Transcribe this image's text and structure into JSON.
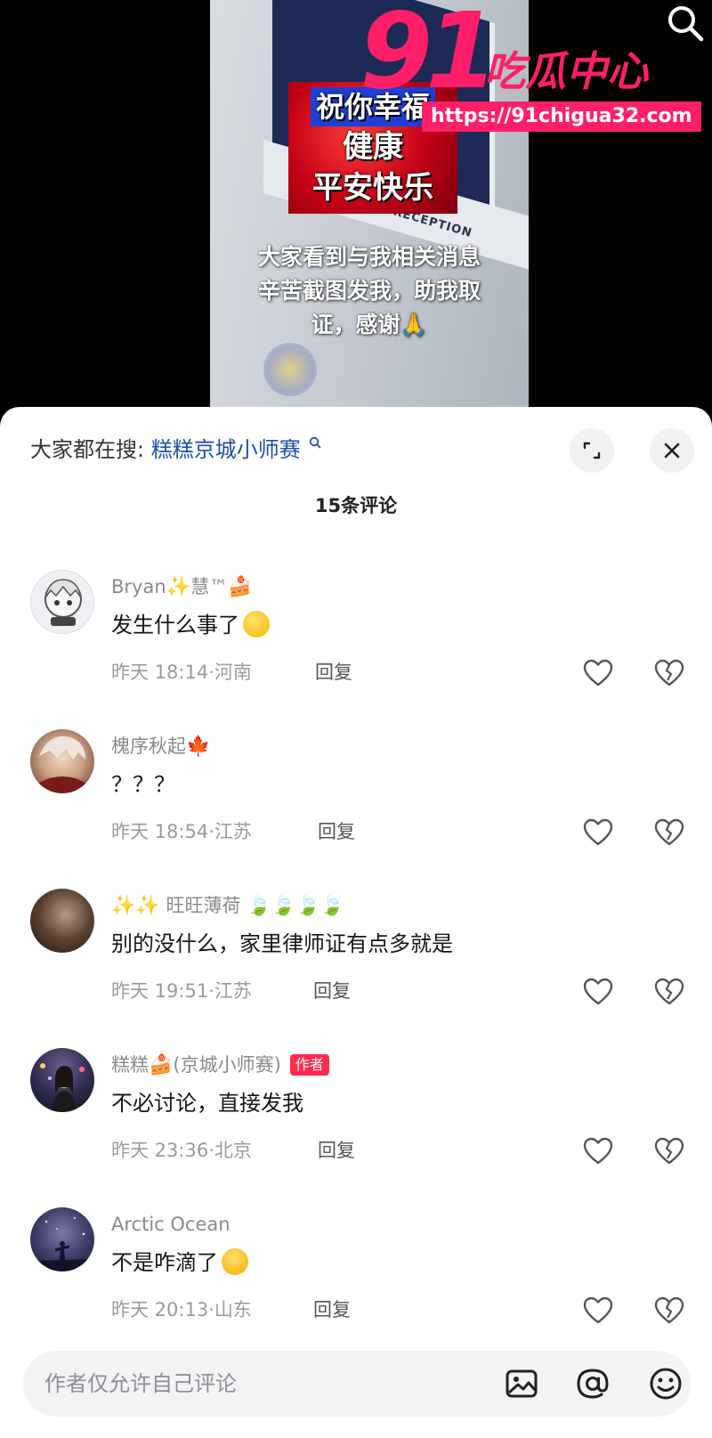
{
  "video": {
    "blessing_lines": [
      "祝你幸福",
      "健康",
      "平安快乐"
    ],
    "sign_text": "POLICE RECEPTION",
    "caption_lines": [
      "大家看到与我相关消息",
      "辛苦截图发我，助我取",
      "证，感谢🙏"
    ]
  },
  "watermark": {
    "number": "91",
    "name": "吃瓜中心",
    "url": "https://91chigua32.com"
  },
  "header": {
    "hot_search_label": "大家都在搜:",
    "hot_search_term": "糕糕京城小师赛",
    "comment_count": "15条评论"
  },
  "comments": [
    {
      "name": "Bryan",
      "name_suffix": "慧™",
      "text": "发生什么事了",
      "time": "昨天 18:14",
      "location": "河南",
      "reply": "回复"
    },
    {
      "name": "槐序秋起",
      "name_suffix": "",
      "text": "？？？",
      "time": "昨天 18:54",
      "location": "江苏",
      "reply": "回复"
    },
    {
      "name": "旺旺薄荷",
      "name_suffix": "",
      "text": "别的没什么，家里律师证有点多就是",
      "time": "昨天 19:51",
      "location": "江苏",
      "reply": "回复"
    },
    {
      "name": "糕糕",
      "name_suffix": "(京城小师赛)",
      "author_tag": "作者",
      "text": "不必讨论，直接发我",
      "time": "昨天 23:36",
      "location": "北京",
      "reply": "回复"
    },
    {
      "name": "Arctic Ocean",
      "name_suffix": "",
      "text": "不是咋滴了",
      "time": "昨天 20:13",
      "location": "山东",
      "reply": "回复"
    }
  ],
  "input": {
    "placeholder": "作者仅允许自己评论"
  },
  "icons": {
    "top_search": "search-icon",
    "expand": "expand-icon",
    "close": "close-icon",
    "like": "heart-icon",
    "dislike": "broken-heart-icon",
    "image": "image-icon",
    "mention": "at-icon",
    "emoji": "emoji-icon"
  },
  "colors": {
    "link": "#1e4fa8",
    "author_tag": "#ff2b4f",
    "watermark": "#ff1f68"
  }
}
